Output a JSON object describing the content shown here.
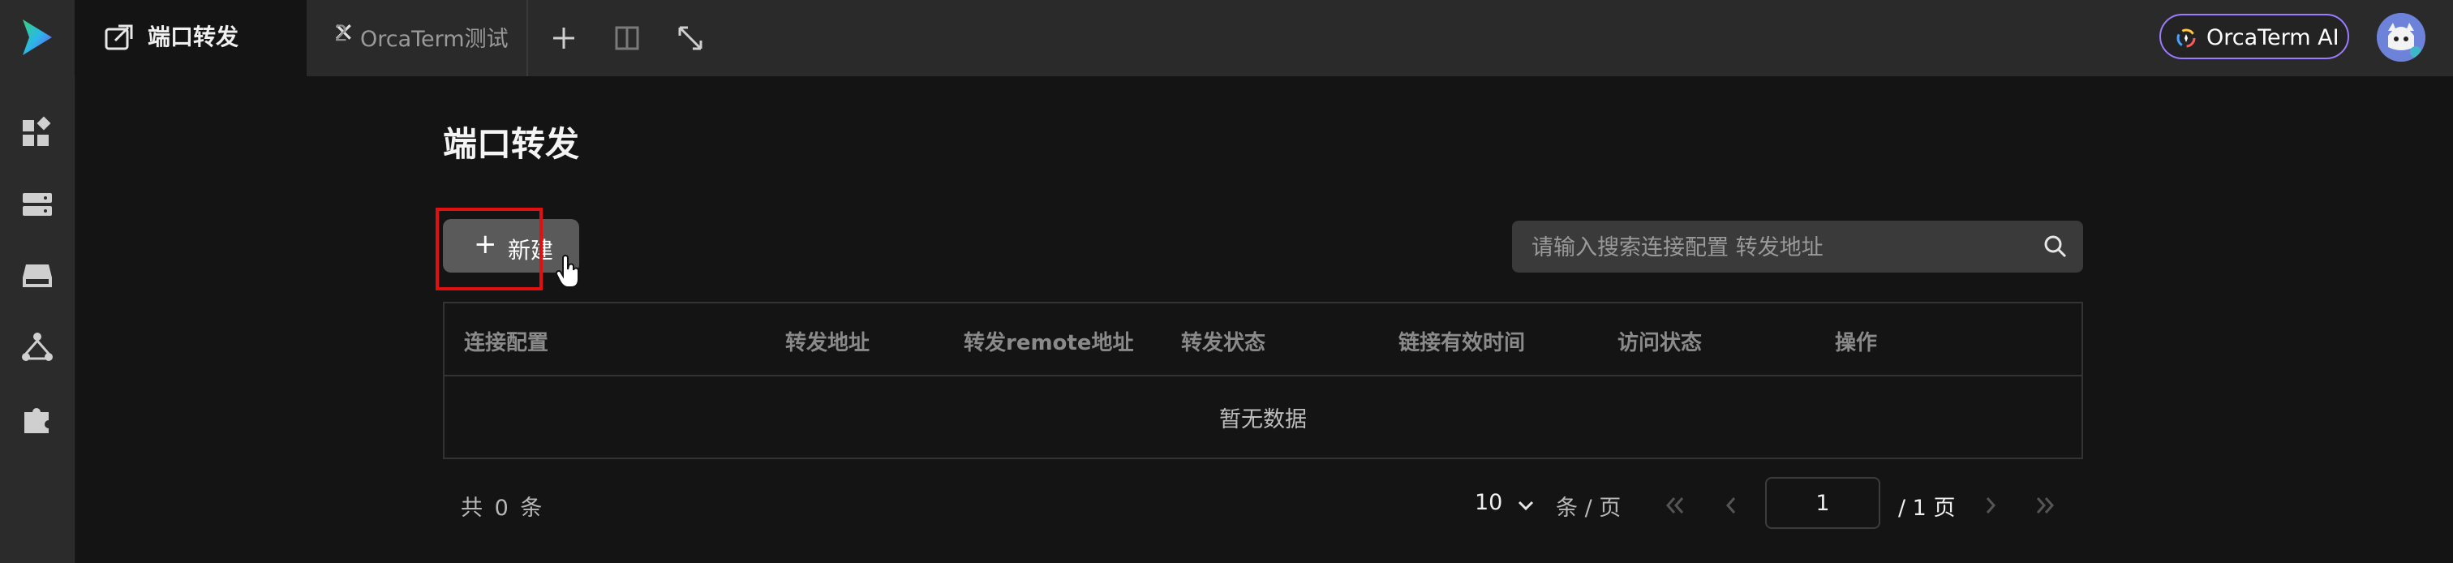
{
  "tabs": [
    {
      "label": "端口转发",
      "close": "✕"
    },
    {
      "index": "2",
      "label": "OrcaTerm测试"
    }
  ],
  "toolbar": {
    "add_icon": "plus-icon",
    "split_icon": "split-view-icon",
    "fullscreen_icon": "expand-icon"
  },
  "ai_button": {
    "label": "OrcaTerm AI"
  },
  "sidebar": {
    "items": [
      {
        "icon": "dashboard-icon"
      },
      {
        "icon": "servers-icon"
      },
      {
        "icon": "storage-icon"
      },
      {
        "icon": "network-icon"
      },
      {
        "icon": "plugin-icon"
      }
    ]
  },
  "main": {
    "title": "端口转发",
    "new_button": {
      "plus": "+",
      "label": "新建"
    },
    "search": {
      "placeholder": "请输入搜索连接配置 转发地址"
    },
    "table": {
      "columns": [
        "连接配置",
        "转发地址",
        "转发remote地址",
        "转发状态",
        "链接有效时间",
        "访问状态",
        "操作"
      ],
      "rows": [],
      "empty_text": "暂无数据"
    },
    "pagination": {
      "total_text": "共 0 条",
      "page_size": "10",
      "per_page_text": "条 / 页",
      "current_page": "1",
      "total_pages_text": "/ 1 页"
    }
  },
  "colors": {
    "accent": "#9c7bff",
    "highlight": "#e01010",
    "background": "#141414"
  }
}
